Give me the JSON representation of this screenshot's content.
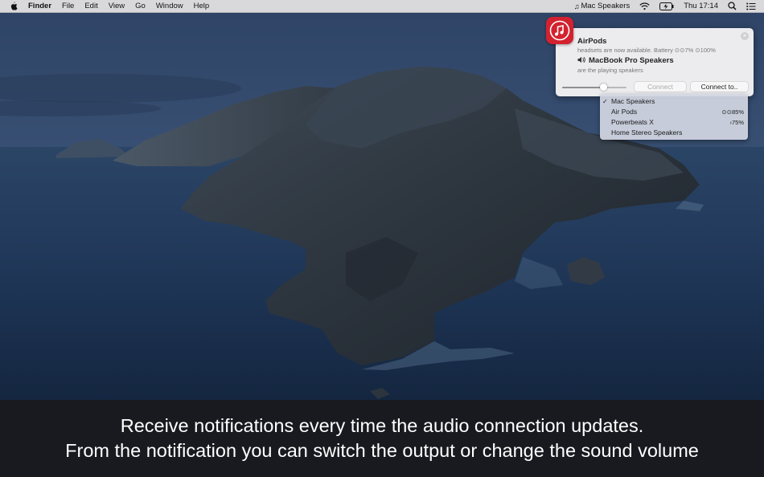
{
  "menubar": {
    "apple_icon": "apple-logo-icon",
    "app_name": "Finder",
    "menus": [
      "File",
      "Edit",
      "View",
      "Go",
      "Window",
      "Help"
    ],
    "status": {
      "audio_output_label": "Mac Speakers",
      "clock": "Thu 17:14"
    }
  },
  "notification": {
    "app_icon": "music-note-icon",
    "title": "AirPods",
    "subtitle": "headsets are now available. Battery ⊙⊙7% ⊙100%",
    "speaker_name": "MacBook Pro Speakers",
    "speaker_subtitle": "are the playing speakers",
    "volume_percent": 64,
    "connect_label": "Connect",
    "connect_to_label": "Connect to.."
  },
  "dropdown": {
    "items": [
      {
        "label": "Mac Speakers",
        "selected": true,
        "right": ""
      },
      {
        "label": "Air Pods",
        "selected": false,
        "right": "⊙⊙85%"
      },
      {
        "label": "Powerbeats X",
        "selected": false,
        "right": "›75%"
      },
      {
        "label": "Home Stereo Speakers",
        "selected": false,
        "right": ""
      }
    ],
    "check_mark": "✓"
  },
  "caption": {
    "line1": "Receive notifications every time the audio connection updates.",
    "line2": "From the notification you can switch the output or change the sound volume"
  },
  "colors": {
    "app_icon_red": "#d3222f",
    "caption_bg": "#181a1f",
    "menubar_bg": "#d9d9dc"
  }
}
